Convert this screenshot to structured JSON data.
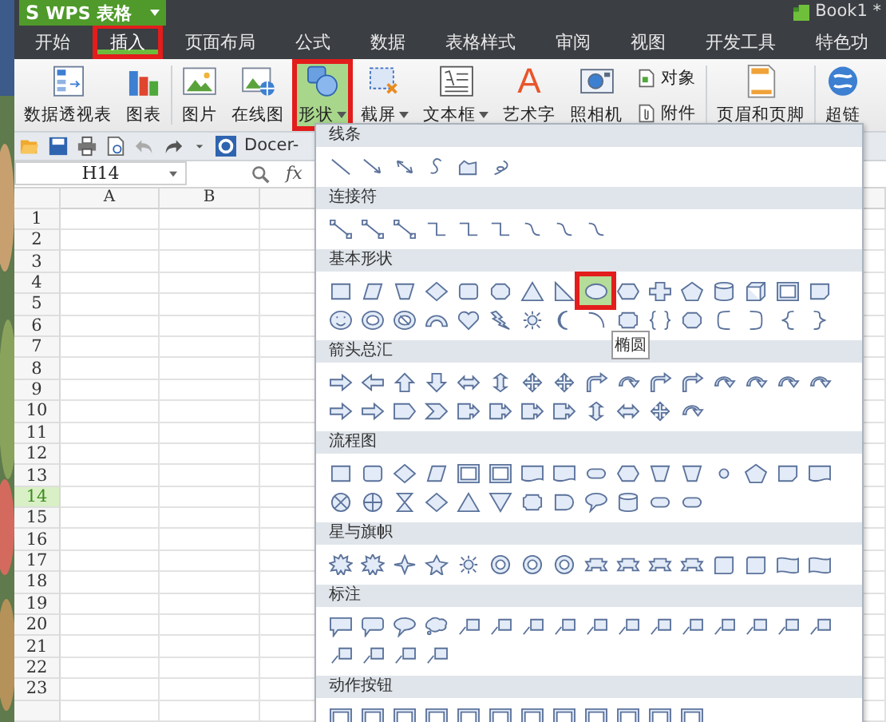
{
  "app_button": {
    "logo": "S",
    "label": "WPS 表格"
  },
  "document_title": "Book1 *",
  "tabs": [
    {
      "label": "开始",
      "selected": false,
      "marked": false
    },
    {
      "label": "插入",
      "selected": true,
      "marked": true
    },
    {
      "label": "页面布局",
      "selected": false,
      "marked": false
    },
    {
      "label": "公式",
      "selected": false,
      "marked": false
    },
    {
      "label": "数据",
      "selected": false,
      "marked": false
    },
    {
      "label": "表格样式",
      "selected": false,
      "marked": false
    },
    {
      "label": "审阅",
      "selected": false,
      "marked": false
    },
    {
      "label": "视图",
      "selected": false,
      "marked": false
    },
    {
      "label": "开发工具",
      "selected": false,
      "marked": false
    },
    {
      "label": "特色功",
      "selected": false,
      "marked": false
    }
  ],
  "ribbon_groups": [
    [
      {
        "kind": "large",
        "label": "数据透视表",
        "caret": false,
        "active": false,
        "marked": false
      },
      {
        "kind": "large",
        "label": "图表",
        "caret": false,
        "active": false,
        "marked": false
      }
    ],
    [
      {
        "kind": "large",
        "label": "图片",
        "caret": false,
        "active": false,
        "marked": false
      },
      {
        "kind": "large",
        "label": "在线图",
        "caret": false,
        "active": false,
        "marked": false
      },
      {
        "kind": "large",
        "label": "形状",
        "caret": true,
        "active": true,
        "marked": true
      },
      {
        "kind": "large",
        "label": "截屏",
        "caret": true,
        "active": false,
        "marked": false
      },
      {
        "kind": "large",
        "label": "文本框",
        "caret": true,
        "active": false,
        "marked": false
      },
      {
        "kind": "large",
        "glyph": "A",
        "label": "艺术字",
        "caret": false,
        "active": false,
        "marked": false
      },
      {
        "kind": "large",
        "label": "照相机",
        "caret": false,
        "active": false,
        "marked": false
      },
      {
        "kind": "small",
        "label": "对象"
      },
      {
        "kind": "small",
        "label": "附件"
      }
    ],
    [
      {
        "kind": "large",
        "label": "页眉和页脚",
        "caret": false,
        "active": false,
        "marked": false
      }
    ],
    [
      {
        "kind": "large",
        "label": "超链",
        "caret": false,
        "active": false,
        "marked": false
      }
    ]
  ],
  "quick_access": {
    "docer_label": "Docer-"
  },
  "formula_bar": {
    "name_box": "H14",
    "fx_label": "fx"
  },
  "columns": [
    "A",
    "B"
  ],
  "rows": [
    {
      "label": "1",
      "selected": false
    },
    {
      "label": "2",
      "selected": false
    },
    {
      "label": "3",
      "selected": false
    },
    {
      "label": "4",
      "selected": false
    },
    {
      "label": "5",
      "selected": false
    },
    {
      "label": "6",
      "selected": false
    },
    {
      "label": "7",
      "selected": false
    },
    {
      "label": "8",
      "selected": false
    },
    {
      "label": "9",
      "selected": false
    },
    {
      "label": "10",
      "selected": false
    },
    {
      "label": "11",
      "selected": false
    },
    {
      "label": "12",
      "selected": false
    },
    {
      "label": "13",
      "selected": false
    },
    {
      "label": "14",
      "selected": true
    },
    {
      "label": "15",
      "selected": false
    },
    {
      "label": "16",
      "selected": false
    },
    {
      "label": "17",
      "selected": false
    },
    {
      "label": "18",
      "selected": false
    },
    {
      "label": "19",
      "selected": false
    },
    {
      "label": "20",
      "selected": false
    },
    {
      "label": "21",
      "selected": false
    },
    {
      "label": "22",
      "selected": false
    },
    {
      "label": "23",
      "selected": false
    }
  ],
  "shapes_panel": {
    "sections": [
      {
        "title": "线条",
        "shapes": [
          {
            "kind": "line",
            "selected": false
          },
          {
            "kind": "arrow",
            "selected": false
          },
          {
            "kind": "double-arrow",
            "selected": false
          },
          {
            "kind": "curve",
            "selected": false
          },
          {
            "kind": "freeform",
            "selected": false
          },
          {
            "kind": "scribble",
            "selected": false
          }
        ]
      },
      {
        "title": "连接符",
        "shapes": [
          {
            "kind": "connector",
            "selected": false
          },
          {
            "kind": "connector",
            "selected": false
          },
          {
            "kind": "connector",
            "selected": false
          },
          {
            "kind": "elbow",
            "selected": false
          },
          {
            "kind": "elbow",
            "selected": false
          },
          {
            "kind": "elbow",
            "selected": false
          },
          {
            "kind": "curved",
            "selected": false
          },
          {
            "kind": "curved",
            "selected": false
          },
          {
            "kind": "curved",
            "selected": false
          }
        ]
      },
      {
        "title": "基本形状",
        "shapes": [
          {
            "kind": "rect",
            "selected": false
          },
          {
            "kind": "parallelogram",
            "selected": false
          },
          {
            "kind": "trapezoid",
            "selected": false
          },
          {
            "kind": "diamond",
            "selected": false
          },
          {
            "kind": "round-rect",
            "selected": false
          },
          {
            "kind": "octagon",
            "selected": false
          },
          {
            "kind": "triangle",
            "selected": false
          },
          {
            "kind": "right-triangle",
            "selected": false
          },
          {
            "kind": "ellipse",
            "selected": true,
            "tooltip": "椭圆"
          },
          {
            "kind": "hexagon",
            "selected": false
          },
          {
            "kind": "cross",
            "selected": false
          },
          {
            "kind": "pentagon",
            "selected": false
          },
          {
            "kind": "can",
            "selected": false
          },
          {
            "kind": "cube",
            "selected": false
          },
          {
            "kind": "frame",
            "selected": false
          },
          {
            "kind": "folded-corner",
            "selected": false
          },
          {
            "kind": "smiley",
            "selected": false
          },
          {
            "kind": "donut",
            "selected": false
          },
          {
            "kind": "no-symbol",
            "selected": false
          },
          {
            "kind": "block-arc",
            "selected": false
          },
          {
            "kind": "heart",
            "selected": false
          },
          {
            "kind": "lightning",
            "selected": false
          },
          {
            "kind": "sun",
            "selected": false
          },
          {
            "kind": "moon",
            "selected": false
          },
          {
            "kind": "arc",
            "selected": false
          },
          {
            "kind": "plaque",
            "selected": false
          },
          {
            "kind": "brace-pair",
            "selected": false
          },
          {
            "kind": "octagon",
            "selected": false
          },
          {
            "kind": "left-bracket",
            "selected": false
          },
          {
            "kind": "right-bracket",
            "selected": false
          },
          {
            "kind": "left-brace",
            "selected": false
          },
          {
            "kind": "right-brace",
            "selected": false
          }
        ]
      },
      {
        "title": "箭头总汇",
        "shapes": [
          {
            "kind": "arrow-right",
            "selected": false
          },
          {
            "kind": "arrow-left",
            "selected": false
          },
          {
            "kind": "arrow-up",
            "selected": false
          },
          {
            "kind": "arrow-down",
            "selected": false
          },
          {
            "kind": "arrow-lr",
            "selected": false
          },
          {
            "kind": "arrow-ud",
            "selected": false
          },
          {
            "kind": "arrow-quad",
            "selected": false
          },
          {
            "kind": "arrow-quad",
            "selected": false
          },
          {
            "kind": "bent-arrow",
            "selected": false
          },
          {
            "kind": "curved-arrow",
            "selected": false
          },
          {
            "kind": "bent-arrow",
            "selected": false
          },
          {
            "kind": "bent-arrow",
            "selected": false
          },
          {
            "kind": "curved-arrow",
            "selected": false
          },
          {
            "kind": "curved-arrow",
            "selected": false
          },
          {
            "kind": "curved-arrow",
            "selected": false
          },
          {
            "kind": "curved-arrow",
            "selected": false
          },
          {
            "kind": "arrow-right",
            "selected": false
          },
          {
            "kind": "arrow-right",
            "selected": false
          },
          {
            "kind": "pentagon-arrow",
            "selected": false
          },
          {
            "kind": "chevron",
            "selected": false
          },
          {
            "kind": "arrow-callout",
            "selected": false
          },
          {
            "kind": "arrow-callout",
            "selected": false
          },
          {
            "kind": "arrow-callout",
            "selected": false
          },
          {
            "kind": "arrow-callout",
            "selected": false
          },
          {
            "kind": "arrow-ud",
            "selected": false
          },
          {
            "kind": "arrow-lr",
            "selected": false
          },
          {
            "kind": "arrow-quad",
            "selected": false
          },
          {
            "kind": "curved-arrow",
            "selected": false
          }
        ]
      },
      {
        "title": "流程图",
        "shapes": [
          {
            "kind": "rect",
            "selected": false
          },
          {
            "kind": "round-rect",
            "selected": false
          },
          {
            "kind": "diamond",
            "selected": false
          },
          {
            "kind": "parallelogram",
            "selected": false
          },
          {
            "kind": "frame",
            "selected": false
          },
          {
            "kind": "frame",
            "selected": false
          },
          {
            "kind": "document",
            "selected": false
          },
          {
            "kind": "document",
            "selected": false
          },
          {
            "kind": "stadium",
            "selected": false
          },
          {
            "kind": "hexagon",
            "selected": false
          },
          {
            "kind": "trapezoid",
            "selected": false
          },
          {
            "kind": "trapezoid",
            "selected": false
          },
          {
            "kind": "circle",
            "selected": false
          },
          {
            "kind": "pentagon",
            "selected": false
          },
          {
            "kind": "folded-corner",
            "selected": false
          },
          {
            "kind": "document",
            "selected": false
          },
          {
            "kind": "circle-x",
            "selected": false
          },
          {
            "kind": "circle-plus",
            "selected": false
          },
          {
            "kind": "hourglass",
            "selected": false
          },
          {
            "kind": "diamond",
            "selected": false
          },
          {
            "kind": "triangle",
            "selected": false
          },
          {
            "kind": "inv-triangle",
            "selected": false
          },
          {
            "kind": "plaque",
            "selected": false
          },
          {
            "kind": "delay",
            "selected": false
          },
          {
            "kind": "callout-oval",
            "selected": false
          },
          {
            "kind": "can",
            "selected": false
          },
          {
            "kind": "stadium",
            "selected": false
          },
          {
            "kind": "stadium",
            "selected": false
          }
        ]
      },
      {
        "title": "星与旗帜",
        "shapes": [
          {
            "kind": "burst",
            "selected": false
          },
          {
            "kind": "burst",
            "selected": false
          },
          {
            "kind": "star4",
            "selected": false
          },
          {
            "kind": "star5",
            "selected": false
          },
          {
            "kind": "sun",
            "selected": false
          },
          {
            "kind": "badge",
            "selected": false
          },
          {
            "kind": "badge",
            "selected": false
          },
          {
            "kind": "badge",
            "selected": false
          },
          {
            "kind": "ribbon",
            "selected": false
          },
          {
            "kind": "ribbon",
            "selected": false
          },
          {
            "kind": "ribbon",
            "selected": false
          },
          {
            "kind": "ribbon",
            "selected": false
          },
          {
            "kind": "scroll",
            "selected": false
          },
          {
            "kind": "scroll",
            "selected": false
          },
          {
            "kind": "wave",
            "selected": false
          },
          {
            "kind": "wave",
            "selected": false
          }
        ]
      },
      {
        "title": "标注",
        "shapes": [
          {
            "kind": "callout-rect",
            "selected": false
          },
          {
            "kind": "callout-round",
            "selected": false
          },
          {
            "kind": "callout-oval",
            "selected": false
          },
          {
            "kind": "callout-cloud",
            "selected": false
          },
          {
            "kind": "line-callout",
            "selected": false
          },
          {
            "kind": "line-callout",
            "selected": false
          },
          {
            "kind": "line-callout",
            "selected": false
          },
          {
            "kind": "line-callout",
            "selected": false
          },
          {
            "kind": "line-callout",
            "selected": false
          },
          {
            "kind": "line-callout",
            "selected": false
          },
          {
            "kind": "line-callout",
            "selected": false
          },
          {
            "kind": "line-callout",
            "selected": false
          },
          {
            "kind": "line-callout",
            "selected": false
          },
          {
            "kind": "line-callout",
            "selected": false
          },
          {
            "kind": "line-callout",
            "selected": false
          },
          {
            "kind": "line-callout",
            "selected": false
          },
          {
            "kind": "line-callout",
            "selected": false
          },
          {
            "kind": "line-callout",
            "selected": false
          },
          {
            "kind": "line-callout",
            "selected": false
          },
          {
            "kind": "line-callout",
            "selected": false
          }
        ]
      },
      {
        "title": "动作按钮",
        "shapes": [
          {
            "kind": "action",
            "selected": false
          },
          {
            "kind": "action",
            "selected": false
          },
          {
            "kind": "action",
            "selected": false
          },
          {
            "kind": "action",
            "selected": false
          },
          {
            "kind": "action",
            "selected": false
          },
          {
            "kind": "action",
            "selected": false
          },
          {
            "kind": "action",
            "selected": false
          },
          {
            "kind": "action",
            "selected": false
          },
          {
            "kind": "action",
            "selected": false
          },
          {
            "kind": "action",
            "selected": false
          },
          {
            "kind": "action",
            "selected": false
          },
          {
            "kind": "action",
            "selected": false
          }
        ]
      }
    ]
  }
}
